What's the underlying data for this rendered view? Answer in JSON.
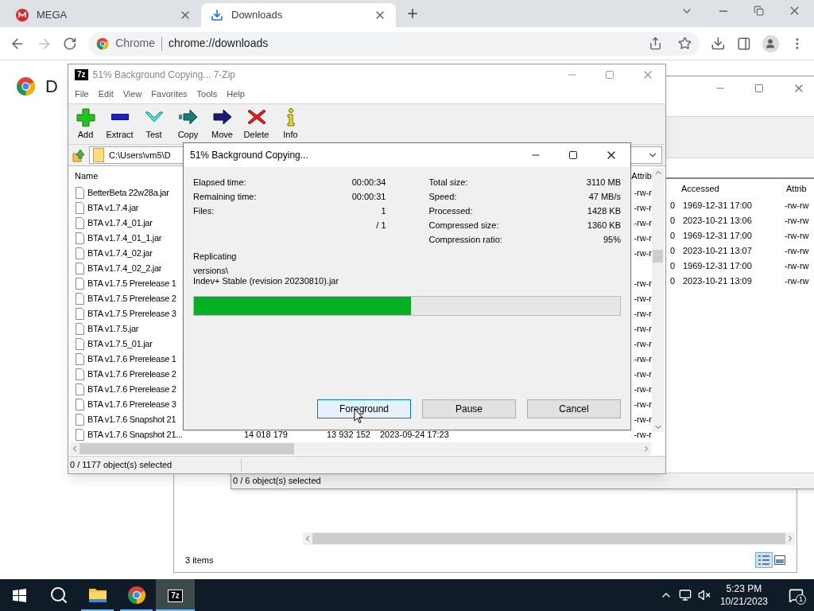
{
  "browser": {
    "tabs": [
      {
        "title": "MEGA",
        "selected": false
      },
      {
        "title": "Downloads",
        "selected": true
      }
    ],
    "omnibox": {
      "site": "Chrome",
      "url": "chrome://downloads"
    },
    "page_heading": "D"
  },
  "back_window": {
    "status": "3 items"
  },
  "second_window": {
    "columns": [
      "Accessed",
      "Attrib"
    ],
    "rows": [
      {
        "size_tail": "0",
        "accessed": "1969-12-31 17:00",
        "attrib": "-rw-rw"
      },
      {
        "size_tail": "0",
        "accessed": "2023-10-21 13:06",
        "attrib": "-rw-rw"
      },
      {
        "size_tail": "0",
        "accessed": "1969-12-31 17:00",
        "attrib": "-rw-rw"
      },
      {
        "size_tail": "0",
        "accessed": "2023-10-21 13:07",
        "attrib": "-rw-rw"
      },
      {
        "size_tail": "0",
        "accessed": "1969-12-31 17:00",
        "attrib": "-rw-rw"
      },
      {
        "size_tail": "0",
        "accessed": "2023-10-21 13:09",
        "attrib": "-rw-rw"
      }
    ],
    "status": "0 / 6 object(s) selected"
  },
  "main_window": {
    "logo": "7z",
    "title": "51% Background Copying... 7-Zip",
    "menu": [
      "File",
      "Edit",
      "View",
      "Favorites",
      "Tools",
      "Help"
    ],
    "toolbar": [
      {
        "label": "Add",
        "kind": "add"
      },
      {
        "label": "Extract",
        "kind": "extract"
      },
      {
        "label": "Test",
        "kind": "test"
      },
      {
        "label": "Copy",
        "kind": "copy"
      },
      {
        "label": "Move",
        "kind": "move"
      },
      {
        "label": "Delete",
        "kind": "delete"
      },
      {
        "label": "Info",
        "kind": "info"
      }
    ],
    "path": "C:\\Users\\vm5\\D",
    "columns": [
      "Name",
      "Attrib"
    ],
    "rows": [
      {
        "name": "BetterBeta 22w28a.jar",
        "attrib": "-rw-r"
      },
      {
        "name": "BTA v1.7.4.jar",
        "attrib": "-rw-r"
      },
      {
        "name": "BTA v1.7.4_01.jar",
        "attrib": "-rw-r"
      },
      {
        "name": "BTA v1.7.4_01_1.jar",
        "attrib": "-rw-r"
      },
      {
        "name": "BTA v1.7.4_02.jar",
        "attrib": "-rw-r"
      },
      {
        "name": "BTA v1.7.4_02_2.jar"
      },
      {
        "name": "BTA v1.7.5 Prerelease 1",
        "attrib": "-rw-r"
      },
      {
        "name": "BTA v1.7.5 Prerelease 2",
        "attrib": "-rw-r"
      },
      {
        "name": "BTA v1.7.5 Prerelease 3",
        "attrib": "-rw-r"
      },
      {
        "name": "BTA v1.7.5.jar",
        "attrib": "-rw-r"
      },
      {
        "name": "BTA v1.7.5_01.jar",
        "attrib": "-rw-r"
      },
      {
        "name": "BTA v1.7.6 Prerelease 1",
        "attrib": "-rw-r"
      },
      {
        "name": "BTA v1.7.6 Prerelease 2",
        "attrib": "-rw-r"
      },
      {
        "name": "BTA v1.7.6 Prerelease 2",
        "attrib": "-rw-r"
      },
      {
        "name": "BTA v1.7.6 Prerelease 3",
        "attrib": "-rw-r"
      },
      {
        "name": "BTA v1.7.6 Snapshot 21",
        "attrib": "-rw-r"
      },
      {
        "name": "BTA v1.7.6 Snapshot 21...",
        "size": "14 018 179",
        "packed": "13 932 152",
        "modified": "2023-09-24 17:23",
        "attrib": "-rw-r"
      }
    ],
    "status": "0 / 1177 object(s) selected"
  },
  "dialog": {
    "title": "51% Background Copying...",
    "left_stats": [
      {
        "label": "Elapsed time:",
        "value": "00:00:34"
      },
      {
        "label": "Remaining time:",
        "value": "00:00:31"
      },
      {
        "label": "Files:",
        "value": "1"
      }
    ],
    "files_total": "/ 1",
    "right_stats": [
      {
        "label": "Total size:",
        "value": "3110 MB"
      },
      {
        "label": "Speed:",
        "value": "47 MB/s"
      },
      {
        "label": "Processed:",
        "value": "1428 KB"
      },
      {
        "label": "Compressed size:",
        "value": "1360 KB"
      },
      {
        "label": "Compression ratio:",
        "value": "95%"
      }
    ],
    "operation": "Replicating",
    "path_lines": [
      "versions\\",
      "Indev+ Stable (revision 20230810).jar"
    ],
    "progress": {
      "level": 0.51
    },
    "buttons": [
      {
        "label": "Foreground",
        "focused": true
      },
      {
        "label": "Pause",
        "focused": false
      },
      {
        "label": "Cancel",
        "focused": false
      }
    ]
  },
  "taskbar": {
    "apps": [
      {
        "kind": "start",
        "running": false,
        "selected": false
      },
      {
        "kind": "search",
        "running": false,
        "selected": false
      },
      {
        "kind": "explorer",
        "running": true,
        "selected": false
      },
      {
        "kind": "chrome",
        "running": true,
        "selected": false
      },
      {
        "kind": "sevenzip",
        "label": "7z",
        "running": true,
        "selected": true
      }
    ],
    "time": "5:23 PM",
    "date": "10/21/2023",
    "notifications": "1"
  }
}
